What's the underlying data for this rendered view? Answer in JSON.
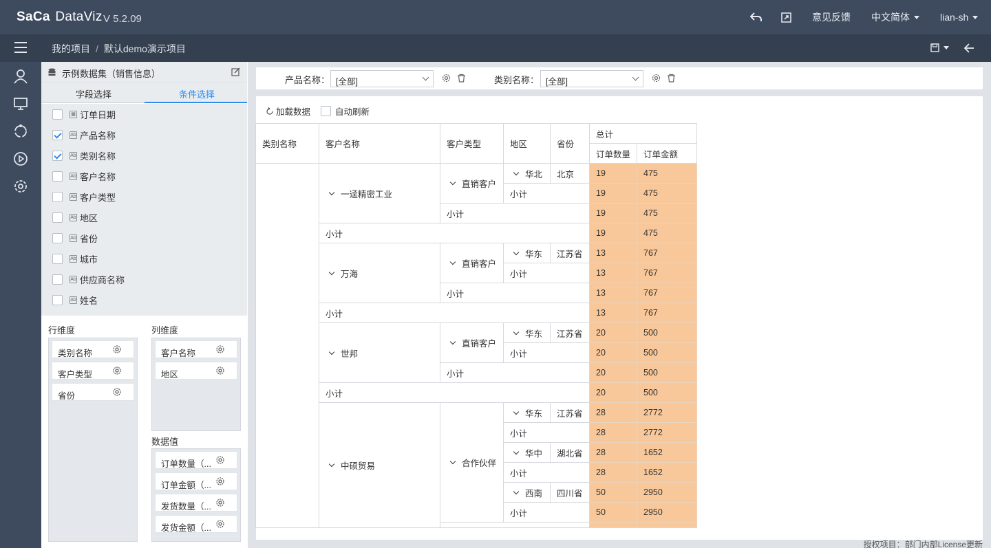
{
  "topbar": {
    "logo_main": "Sa",
    "logo_mid": "Ca",
    "logo_sub": "DataViz",
    "version": "V 5.2.09",
    "feedback": "意见反馈",
    "language": "中文简体",
    "user": "lian-sh"
  },
  "breadcrumb": {
    "root": "我的项目",
    "separator": "/",
    "current": "默认demo演示项目"
  },
  "panel": {
    "title": "示例数据集（销售信息）",
    "tabs": [
      "字段选择",
      "条件选择"
    ],
    "active_tab": 1,
    "fields": [
      {
        "label": "订单日期",
        "checked": false,
        "icon": "calendar-icon"
      },
      {
        "label": "产品名称",
        "checked": true,
        "icon": "text-field-icon"
      },
      {
        "label": "类别名称",
        "checked": true,
        "icon": "text-field-icon"
      },
      {
        "label": "客户名称",
        "checked": false,
        "icon": "text-field-icon"
      },
      {
        "label": "客户类型",
        "checked": false,
        "icon": "text-field-icon"
      },
      {
        "label": "地区",
        "checked": false,
        "icon": "text-field-icon"
      },
      {
        "label": "省份",
        "checked": false,
        "icon": "text-field-icon"
      },
      {
        "label": "城市",
        "checked": false,
        "icon": "text-field-icon"
      },
      {
        "label": "供应商名称",
        "checked": false,
        "icon": "text-field-icon"
      },
      {
        "label": "姓名",
        "checked": false,
        "icon": "text-field-icon"
      }
    ],
    "row_dim_label": "行维度",
    "row_dims": [
      "类别名称",
      "客户类型",
      "省份"
    ],
    "col_dim_label": "列维度",
    "col_dims": [
      "客户名称",
      "地区"
    ],
    "values_label": "数据值",
    "values": [
      "订单数量（...",
      "订单金额（...",
      "发货数量（...",
      "发货金额（..."
    ]
  },
  "filters": [
    {
      "label": "产品名称：",
      "value": "[全部]"
    },
    {
      "label": "类别名称：",
      "value": "[全部]"
    }
  ],
  "toolbar": {
    "load": "加载数据",
    "auto_refresh": "自动刷新"
  },
  "table": {
    "headers": {
      "category": "类别名称",
      "customer": "客户名称",
      "ctype": "客户类型",
      "region": "地区",
      "province": "省份",
      "total": "总计",
      "qty": "订单数量",
      "amount": "订单金额"
    },
    "subtotal": "小计",
    "customers": [
      {
        "name": "一迳精密工业",
        "type": "直销客户",
        "regions": [
          {
            "region": "华北",
            "province": "北京"
          }
        ]
      },
      {
        "name": "万海",
        "type": "直销客户",
        "regions": [
          {
            "region": "华东",
            "province": "江苏省"
          }
        ]
      },
      {
        "name": "世邦",
        "type": "直销客户",
        "regions": [
          {
            "region": "华东",
            "province": "江苏省"
          }
        ]
      },
      {
        "name": "中硕贸易",
        "type": "合作伙伴",
        "regions": [
          {
            "region": "华东",
            "province": "江苏省"
          },
          {
            "region": "华中",
            "province": "湖北省"
          },
          {
            "region": "西南",
            "province": "四川省"
          }
        ]
      }
    ],
    "values": [
      [
        "19",
        "475"
      ],
      [
        "19",
        "475"
      ],
      [
        "19",
        "475"
      ],
      [
        "19",
        "475"
      ],
      [
        "13",
        "767"
      ],
      [
        "13",
        "767"
      ],
      [
        "13",
        "767"
      ],
      [
        "13",
        "767"
      ],
      [
        "20",
        "500"
      ],
      [
        "20",
        "500"
      ],
      [
        "20",
        "500"
      ],
      [
        "20",
        "500"
      ],
      [
        "28",
        "2772"
      ],
      [
        "28",
        "2772"
      ],
      [
        "28",
        "1652"
      ],
      [
        "28",
        "1652"
      ],
      [
        "50",
        "2950"
      ],
      [
        "50",
        "2950"
      ]
    ]
  },
  "footer": "授权项目：部门内部License更新"
}
